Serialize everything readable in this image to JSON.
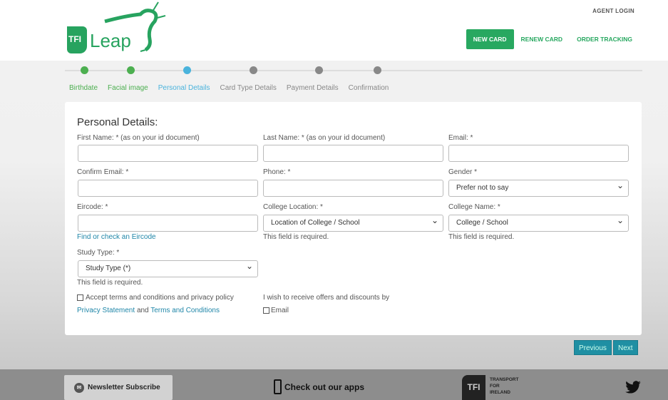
{
  "header": {
    "logo_text": "TFI Leap",
    "agent_login": "AGENT LOGIN",
    "nav": [
      "NEW CARD",
      "RENEW CARD",
      "ORDER TRACKING"
    ]
  },
  "steps": [
    {
      "label": "Birthdate",
      "status": "done",
      "color": "#4caf50"
    },
    {
      "label": "Facial image",
      "status": "done",
      "color": "#4caf50"
    },
    {
      "label": "Personal Details",
      "status": "current",
      "color": "#4ab3dc"
    },
    {
      "label": "Card Type Details",
      "status": "pending",
      "color": "#888888"
    },
    {
      "label": "Payment Details",
      "status": "pending",
      "color": "#888888"
    },
    {
      "label": "Confirmation",
      "status": "pending",
      "color": "#888888"
    }
  ],
  "form": {
    "title": "Personal Details:",
    "first_name": {
      "label": "First Name: * (as on your id document)",
      "value": ""
    },
    "last_name": {
      "label": "Last Name: * (as on your id document)",
      "value": ""
    },
    "email": {
      "label": "Email: *",
      "value": ""
    },
    "confirm_email": {
      "label": "Confirm Email: *",
      "value": ""
    },
    "phone": {
      "label": "Phone: *",
      "value": ""
    },
    "gender": {
      "label": "Gender *",
      "value": "Prefer not to say"
    },
    "eircode": {
      "label": "Eircode: *",
      "value": "",
      "link": "Find or check an Eircode"
    },
    "college_location": {
      "label": "College Location: *",
      "value": "Location of College / School",
      "error": "This field is required."
    },
    "college_name": {
      "label": "College Name: *",
      "value": "College / School",
      "error": "This field is required."
    },
    "study_type": {
      "label": "Study Type: *",
      "value": "Study Type (*)",
      "error": "This field is required."
    },
    "terms": {
      "label": "Accept terms and conditions and privacy policy",
      "privacy": "Privacy Statement",
      "and": "and",
      "terms_link": "Terms and Conditions",
      "checked": false
    },
    "offers": {
      "label": "I wish to receive offers and discounts by",
      "email_label": "Email",
      "checked": false
    }
  },
  "buttons": {
    "previous": "Previous",
    "next": "Next"
  },
  "footer": {
    "newsletter": "Newsletter Subscribe",
    "apps": "Check out our apps",
    "tfi_logo": "TFI",
    "tfi_lines": [
      "TRANSPORT",
      "FOR",
      "IRELAND"
    ]
  }
}
